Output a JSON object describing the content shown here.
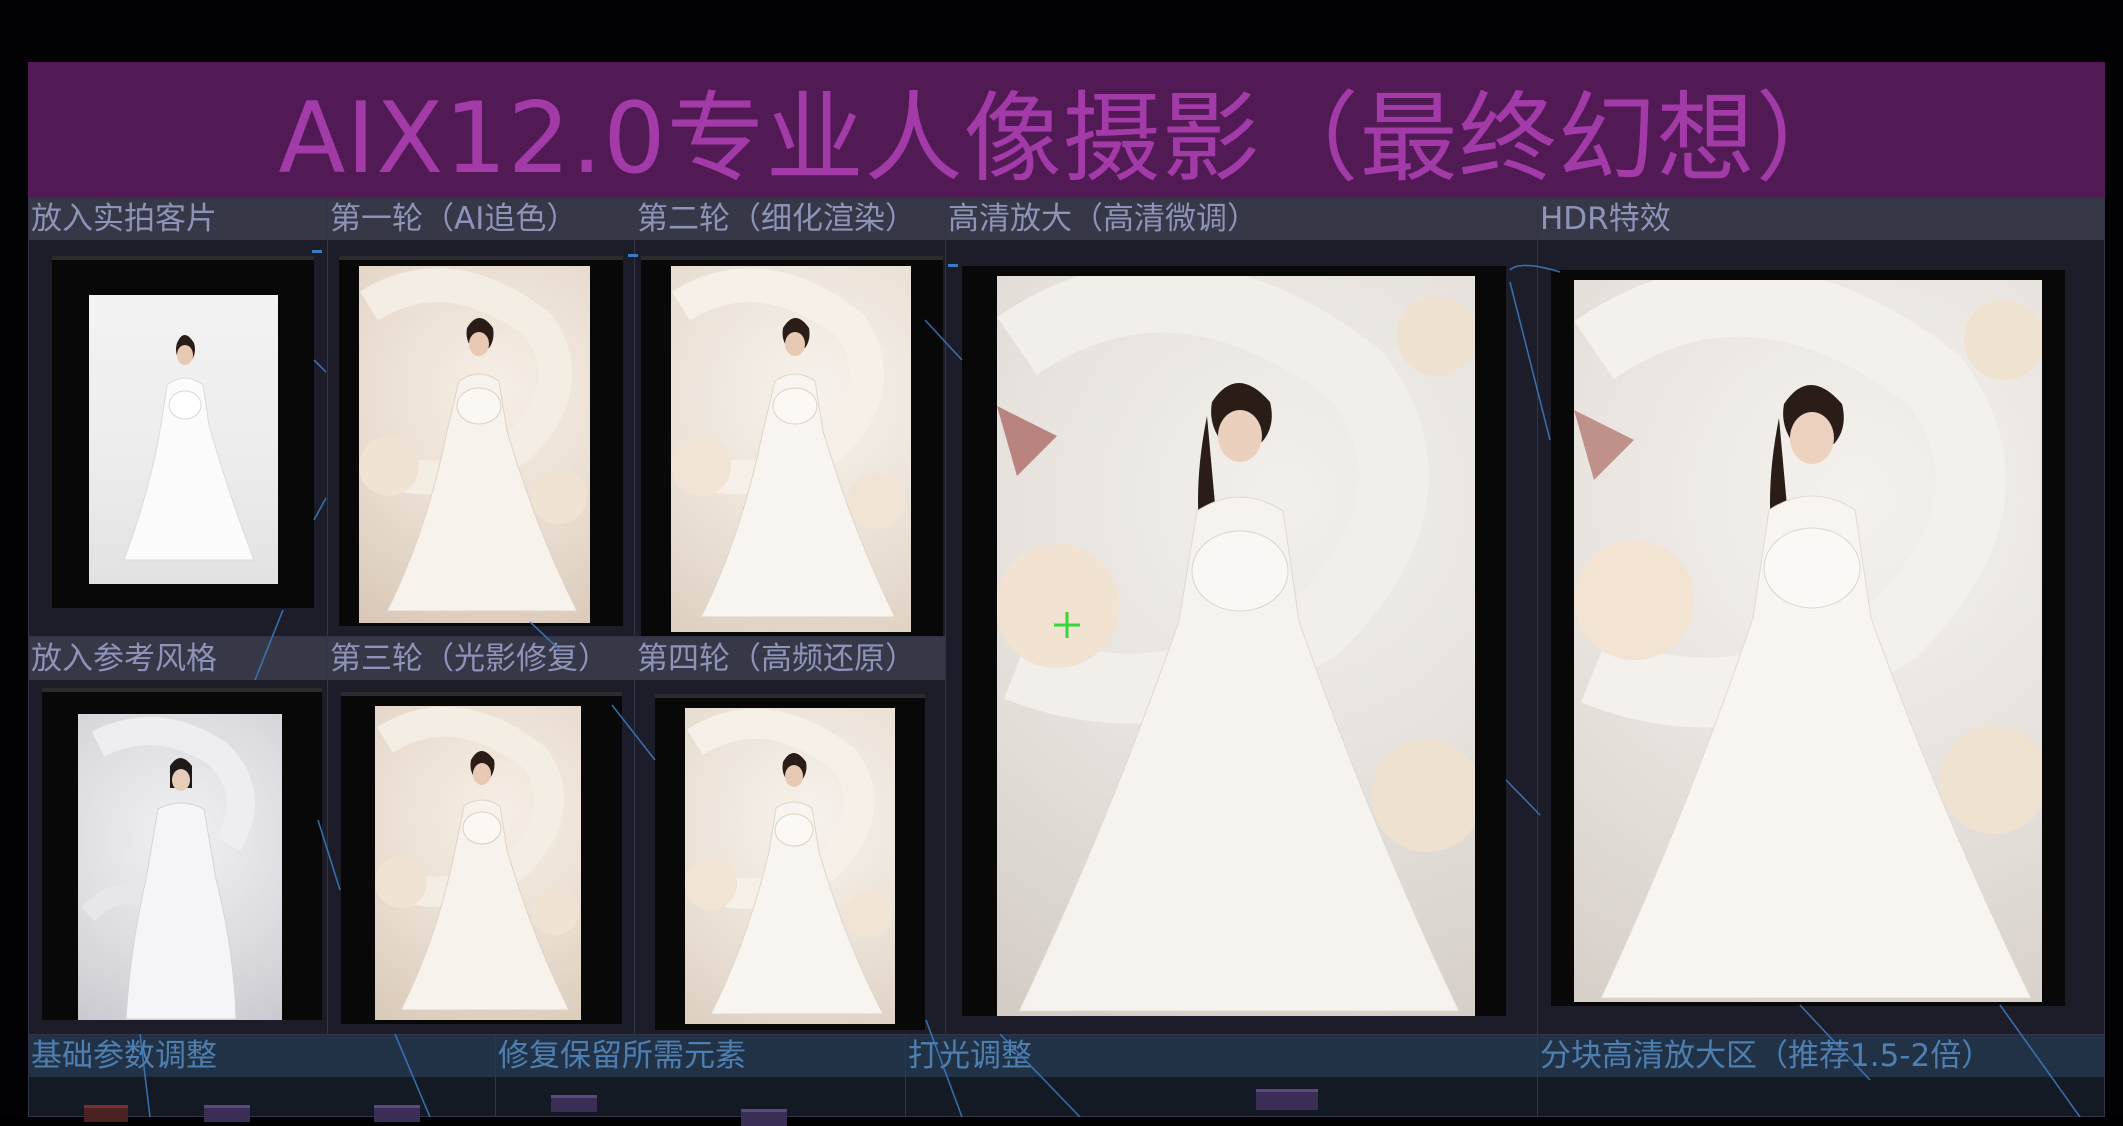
{
  "title": "AIX12.0专业人像摄影（最终幻想）",
  "groups": {
    "input_photo": "放入实拍客片",
    "round1": "第一轮（AI追色）",
    "round2": "第二轮（细化渲染）",
    "upscale": "高清放大（高清微调）",
    "hdr": "HDR特效",
    "reference": "放入参考风格",
    "round3": "第三轮（光影修复）",
    "round4": "第四轮（高频还原）",
    "basic_params": "基础参数调整",
    "repair_keep": "修复保留所需元素",
    "lighting": "打光调整",
    "tiled_upscale": "分块高清放大区（推荐1.5-2倍）"
  },
  "colors": {
    "title_bg": "#521a55",
    "title_text": "#a23aa7",
    "group_bg": "#1c1d29",
    "group_header": "#363747",
    "group_header_blue": "#213246",
    "wire": "#3e7bbf",
    "cursor": "#39d639"
  },
  "icons": {
    "cursor": "crosshair-cursor-icon"
  }
}
